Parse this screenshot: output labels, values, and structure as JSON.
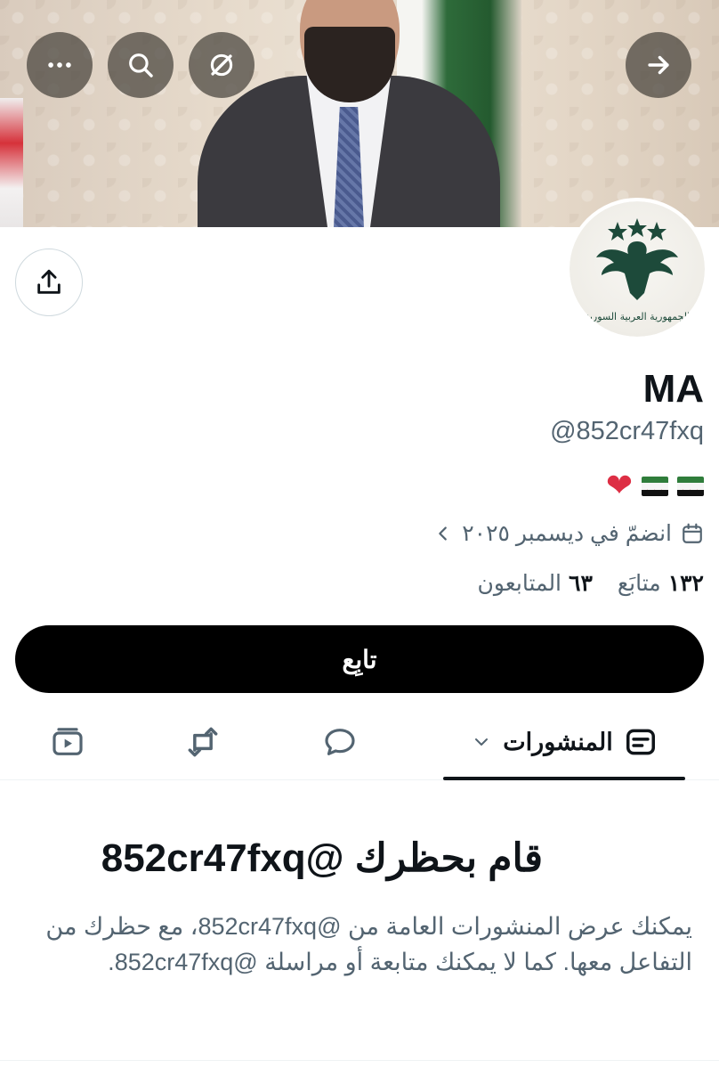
{
  "banner": {
    "more_icon": "more-horizontal-icon",
    "search_icon": "search-icon",
    "translate_icon": "grok-icon",
    "forward_icon": "arrow-right-icon"
  },
  "profile": {
    "name": "MA",
    "handle": "@852cr47fxq",
    "bio_emojis": [
      "flag-syria",
      "flag-syria",
      "red-heart"
    ],
    "joined": "انضمّ في ديسمبر ٢٠٢٥",
    "following_count": "١٣٢",
    "following_label": "متابَع",
    "followers_count": "٦٣",
    "followers_label": "المتابعون",
    "avatar_text": "الجمهورية العربية السورية"
  },
  "actions": {
    "follow_label": "تابِع"
  },
  "tabs": {
    "posts_label": "المنشورات",
    "replies_icon": "reply-bubble-icon",
    "reposts_icon": "repost-icon",
    "media_icon": "media-video-icon"
  },
  "blocked": {
    "title": "قام بحظرك @852cr47fxq",
    "description": "يمكنك عرض المنشورات العامة من @852cr47fxq، مع حظرك من التفاعل معها. كما لا يمكنك متابعة أو مراسلة @852cr47fxq."
  },
  "colors": {
    "text_primary": "#0f1419",
    "text_secondary": "#536471",
    "button_black": "#000000",
    "divider": "#eff3f4"
  }
}
